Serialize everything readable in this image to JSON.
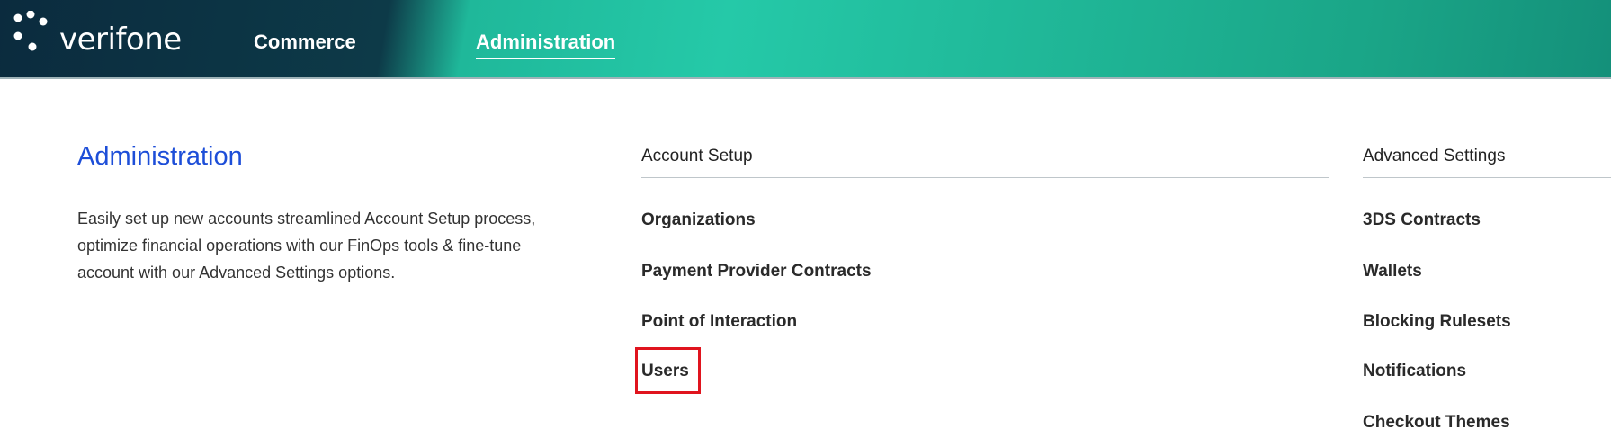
{
  "header": {
    "brand": "verifone",
    "nav": [
      {
        "label": "Commerce"
      },
      {
        "label": "Administration",
        "active": true
      }
    ],
    "colors": {
      "dark": "#0b2b3e",
      "teal": "#25c9a8"
    }
  },
  "main": {
    "title": "Administration",
    "description": "Easily set up new accounts streamlined Account Setup process, optimize financial operations with our FinOps tools & fine-tune account with our Advanced Settings options.",
    "title_color": "#1d4ed8"
  },
  "account_setup": {
    "heading": "Account Setup",
    "links": [
      "Organizations",
      "Payment Provider Contracts",
      "Point of Interaction",
      "Users"
    ]
  },
  "advanced_settings": {
    "heading": "Advanced Settings",
    "links": [
      "3DS Contracts",
      "Wallets",
      "Blocking Rulesets",
      "Notifications",
      "Checkout Themes"
    ]
  },
  "annotation": {
    "highlight_color": "#e0141e",
    "highlighted": "Users"
  }
}
